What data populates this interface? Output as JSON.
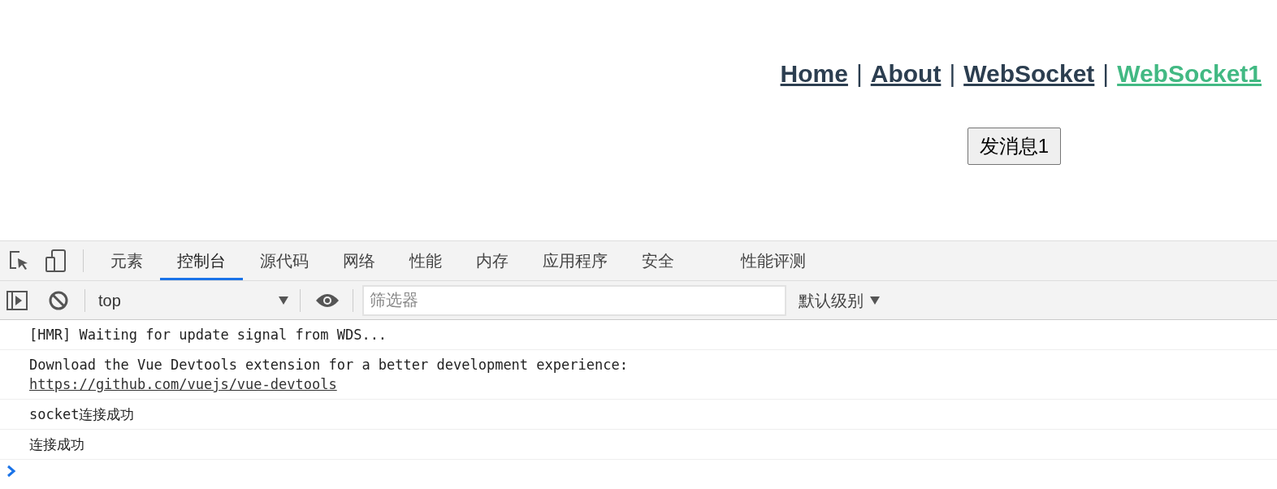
{
  "nav": [
    {
      "kind": "link",
      "label": "Home",
      "selected": false
    },
    {
      "kind": "separator",
      "label": "|"
    },
    {
      "kind": "link",
      "label": "About",
      "selected": false
    },
    {
      "kind": "separator",
      "label": "|"
    },
    {
      "kind": "link",
      "label": "WebSocket",
      "selected": false
    },
    {
      "kind": "separator",
      "label": "|"
    },
    {
      "kind": "link",
      "label": "WebSocket1",
      "selected": true
    }
  ],
  "send_button": "发消息1",
  "devtools": {
    "tabs": [
      {
        "label": "元素",
        "selected": false
      },
      {
        "label": "控制台",
        "selected": true
      },
      {
        "label": "源代码",
        "selected": false
      },
      {
        "label": "网络",
        "selected": false
      },
      {
        "label": "性能",
        "selected": false
      },
      {
        "label": "内存",
        "selected": false
      },
      {
        "label": "应用程序",
        "selected": false
      },
      {
        "label": "安全",
        "selected": false
      },
      {
        "label": "性能评测",
        "selected": false
      }
    ],
    "context": "top",
    "filter": {
      "placeholder": "筛选器"
    },
    "level_dropdown": "默认级别",
    "messages": [
      {
        "text": "[HMR] Waiting for update signal from WDS..."
      },
      {
        "text": "Download the Vue Devtools extension for a better development experience:",
        "link": "https://github.com/vuejs/vue-devtools"
      },
      {
        "text": "socket连接成功"
      },
      {
        "text": "连接成功"
      }
    ]
  }
}
